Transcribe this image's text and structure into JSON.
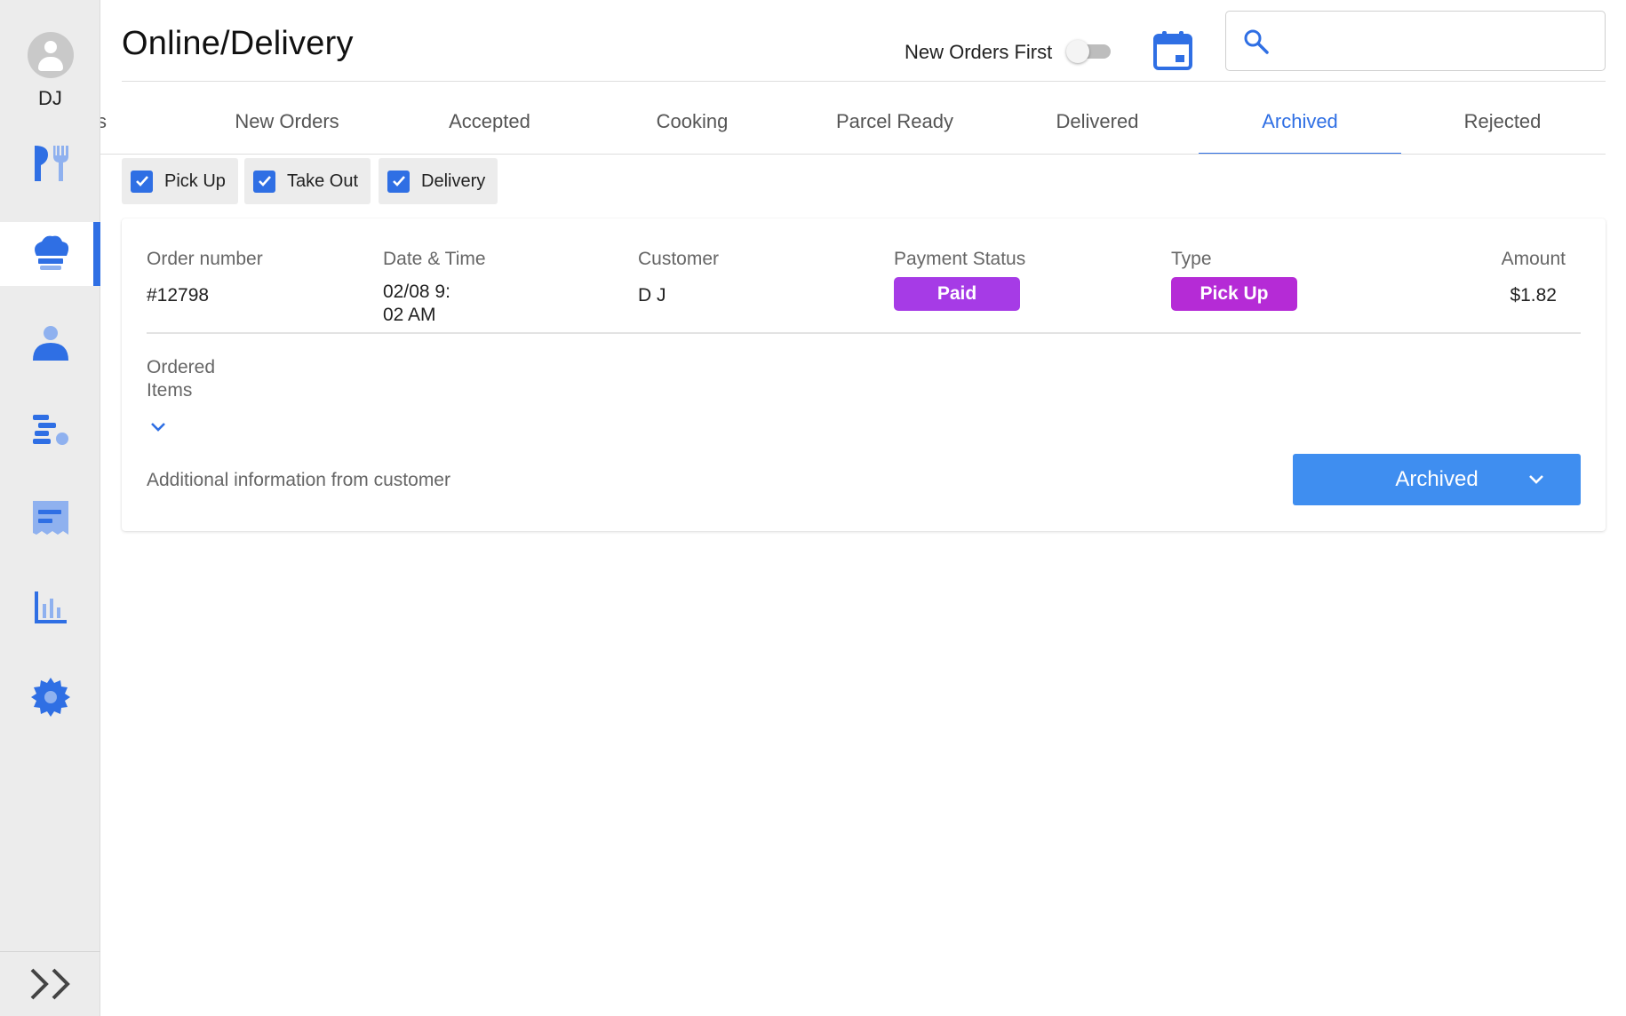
{
  "user": {
    "initials": "DJ"
  },
  "header": {
    "title": "Online/Delivery",
    "new_orders_first_label": "New Orders First",
    "new_orders_first_on": false,
    "search": {
      "value": "",
      "placeholder": ""
    }
  },
  "sidebar": {
    "items": [
      {
        "name": "menu",
        "icon": "utensils-icon",
        "active": false
      },
      {
        "name": "online-delivery",
        "icon": "chef-hat-icon",
        "active": true
      },
      {
        "name": "customers",
        "icon": "person-icon",
        "active": false
      },
      {
        "name": "queue",
        "icon": "list-queue-icon",
        "active": false
      },
      {
        "name": "receipts",
        "icon": "receipt-icon",
        "active": false
      },
      {
        "name": "reports",
        "icon": "bar-chart-icon",
        "active": false
      },
      {
        "name": "settings",
        "icon": "gear-icon",
        "active": false
      }
    ],
    "accent_color": "#2f6fe4"
  },
  "tabs": [
    {
      "label": "rders",
      "active": false
    },
    {
      "label": "New Orders",
      "active": false
    },
    {
      "label": "Accepted",
      "active": false
    },
    {
      "label": "Cooking",
      "active": false
    },
    {
      "label": "Parcel Ready",
      "active": false
    },
    {
      "label": "Delivered",
      "active": false
    },
    {
      "label": "Archived",
      "active": true
    },
    {
      "label": "Rejected",
      "active": false
    }
  ],
  "filters": [
    {
      "label": "Pick Up",
      "checked": true
    },
    {
      "label": "Take Out",
      "checked": true
    },
    {
      "label": "Delivery",
      "checked": true
    }
  ],
  "order": {
    "headers": {
      "order_number": "Order number",
      "date_time": "Date & Time",
      "customer": "Customer",
      "payment_status": "Payment Status",
      "type": "Type",
      "amount": "Amount"
    },
    "order_number": "#12798",
    "date_time": "02/08 9:\n02 AM",
    "customer": "D J",
    "payment_status": "Paid",
    "payment_status_color": "#a63be6",
    "type": "Pick Up",
    "type_color": "#b52bd6",
    "amount": "$1.82",
    "ordered_items_label": "Ordered Items",
    "additional_info_label": "Additional information from customer",
    "status_select": "Archived",
    "status_select_color": "#3f8ef0"
  }
}
